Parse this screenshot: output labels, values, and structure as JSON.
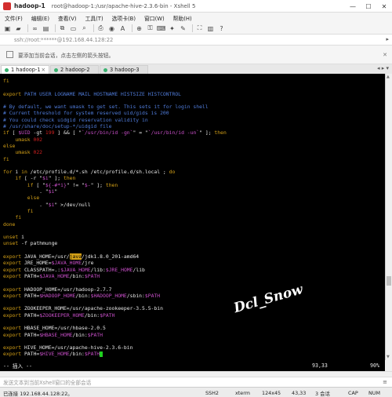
{
  "window": {
    "tab_title": "hadoop-1",
    "description": "root@hadoop-1:/usr/apache-hive-2.3.6-bin - Xshell 5",
    "minimize": "—",
    "maximize": "☐",
    "close": "✕"
  },
  "menu": [
    "文件(F)",
    "编辑(E)",
    "查看(V)",
    "工具(T)",
    "选项卡(B)",
    "窗口(W)",
    "帮助(H)"
  ],
  "address": {
    "value": "ssh://root:******@192.168.44.128:22"
  },
  "hint": {
    "text": "要添加当前会话，点击左侧的箭头按钮。"
  },
  "tabs": [
    {
      "label": "1 hadoop-1",
      "color": "#3cb371",
      "active": true
    },
    {
      "label": "2 hadoop-2",
      "color": "#3cb371",
      "active": false
    },
    {
      "label": "3 hadoop-3",
      "color": "#3cb371",
      "active": false
    }
  ],
  "terminal": {
    "lines": [
      [
        [
          "fi",
          "kw"
        ]
      ],
      [
        [
          "",
          ""
        ]
      ],
      [
        [
          "export",
          "kw"
        ],
        [
          " PATH USER LOGNAME MAIL HOSTNAME HISTSIZE HISTCONTROL",
          "cmt"
        ]
      ],
      [
        [
          "",
          ""
        ]
      ],
      [
        [
          "# By default, we want umask to get set. This sets it for login shell",
          "cmt"
        ]
      ],
      [
        [
          "# Current threshold for system reserved uid/gids is 200",
          "cmt"
        ]
      ],
      [
        [
          "# You could check uidgid reservation validity in",
          "cmt"
        ]
      ],
      [
        [
          "# /usr/share/doc/setup-*/uidgid file",
          "cmt"
        ]
      ],
      [
        [
          "if",
          "kw"
        ],
        [
          " [ ",
          "wht"
        ],
        [
          "$UID",
          "var"
        ],
        [
          " -gt ",
          "wht"
        ],
        [
          "199",
          "red"
        ],
        [
          " ] && [ \"",
          "wht"
        ],
        [
          "`/usr/bin/id -gn`",
          "str"
        ],
        [
          "\" = \"",
          "wht"
        ],
        [
          "`/usr/bin/id -un`",
          "str"
        ],
        [
          "\" ]; ",
          "wht"
        ],
        [
          "then",
          "kw"
        ]
      ],
      [
        [
          "    umask ",
          "kw"
        ],
        [
          "002",
          "red"
        ]
      ],
      [
        [
          "else",
          "kw"
        ]
      ],
      [
        [
          "    umask ",
          "kw"
        ],
        [
          "022",
          "red"
        ]
      ],
      [
        [
          "fi",
          "kw"
        ]
      ],
      [
        [
          "",
          ""
        ]
      ],
      [
        [
          "for",
          "kw"
        ],
        [
          " i ",
          "wht"
        ],
        [
          "in",
          "kw"
        ],
        [
          " /etc/profile.d/*.sh /etc/profile.d/sh.local ; ",
          "wht"
        ],
        [
          "do",
          "kw"
        ]
      ],
      [
        [
          "    if",
          "kw"
        ],
        [
          " [ -r \"",
          "wht"
        ],
        [
          "$i",
          "var"
        ],
        [
          "\" ]; ",
          "wht"
        ],
        [
          "then",
          "kw"
        ]
      ],
      [
        [
          "        if",
          "kw"
        ],
        [
          " [ \"",
          "wht"
        ],
        [
          "${-#*i}",
          "var"
        ],
        [
          "\" != \"",
          "wht"
        ],
        [
          "$-",
          "var"
        ],
        [
          "\" ]; ",
          "wht"
        ],
        [
          "then",
          "kw"
        ]
      ],
      [
        [
          "            . \"",
          "wht"
        ],
        [
          "$i",
          "var"
        ],
        [
          "\"",
          "wht"
        ]
      ],
      [
        [
          "        else",
          "kw"
        ]
      ],
      [
        [
          "            . \"",
          "wht"
        ],
        [
          "$i",
          "var"
        ],
        [
          "\" >/dev/null",
          "wht"
        ]
      ],
      [
        [
          "        fi",
          "kw"
        ]
      ],
      [
        [
          "    fi",
          "kw"
        ]
      ],
      [
        [
          "done",
          "kw"
        ]
      ],
      [
        [
          "",
          ""
        ]
      ],
      [
        [
          "unset",
          "kw"
        ],
        [
          " i",
          "wht"
        ]
      ],
      [
        [
          "unset",
          "kw"
        ],
        [
          " -f pathmunge",
          "wht"
        ]
      ],
      [
        [
          "",
          ""
        ]
      ],
      [
        [
          "export",
          "kw"
        ],
        [
          " JAVA_HOME=/usr/",
          "wht"
        ],
        [
          "java",
          "hl"
        ],
        [
          "/jdk1.8.0_201-amd64",
          "wht"
        ]
      ],
      [
        [
          "export",
          "kw"
        ],
        [
          " JRE_HOME=",
          "wht"
        ],
        [
          "$JAVA_HOME",
          "var"
        ],
        [
          "/jre",
          "wht"
        ]
      ],
      [
        [
          "export",
          "kw"
        ],
        [
          " CLASSPATH=.:",
          "wht"
        ],
        [
          "$JAVA_HOME",
          "var"
        ],
        [
          "/lib:",
          "wht"
        ],
        [
          "$JRE_HOME",
          "var"
        ],
        [
          "/lib",
          "wht"
        ]
      ],
      [
        [
          "export",
          "kw"
        ],
        [
          " PATH=",
          "wht"
        ],
        [
          "$JAVA_HOME",
          "var"
        ],
        [
          "/bin:",
          "wht"
        ],
        [
          "$PATH",
          "var"
        ]
      ],
      [
        [
          "",
          ""
        ]
      ],
      [
        [
          "export",
          "kw"
        ],
        [
          " HADOOP_HOME=/usr/hadoop-2.7.7",
          "wht"
        ]
      ],
      [
        [
          "export",
          "kw"
        ],
        [
          " PATH=",
          "wht"
        ],
        [
          "$HADOOP_HOME",
          "var"
        ],
        [
          "/bin:",
          "wht"
        ],
        [
          "$HADOOP_HOME",
          "var"
        ],
        [
          "/sbin:",
          "wht"
        ],
        [
          "$PATH",
          "var"
        ]
      ],
      [
        [
          "",
          ""
        ]
      ],
      [
        [
          "export",
          "kw"
        ],
        [
          " ZOOKEEPER_HOME=/usr/apache-zookeeper-3.5.5-bin",
          "wht"
        ]
      ],
      [
        [
          "export",
          "kw"
        ],
        [
          " PATH=",
          "wht"
        ],
        [
          "$ZOOKEEPER_HOME",
          "var"
        ],
        [
          "/bin:",
          "wht"
        ],
        [
          "$PATH",
          "var"
        ]
      ],
      [
        [
          "",
          ""
        ]
      ],
      [
        [
          "export",
          "kw"
        ],
        [
          " HBASE_HOME=/usr/hbase-2.0.5",
          "wht"
        ]
      ],
      [
        [
          "export",
          "kw"
        ],
        [
          " PATH=",
          "wht"
        ],
        [
          "$HBASE_HOME",
          "var"
        ],
        [
          "/bin:",
          "wht"
        ],
        [
          "$PATH",
          "var"
        ]
      ],
      [
        [
          "",
          ""
        ]
      ],
      [
        [
          "export",
          "kw"
        ],
        [
          " HIVE_HOME=/usr/apache-hive-2.3.6-bin",
          "wht"
        ]
      ],
      [
        [
          "export",
          "kw"
        ],
        [
          " PATH=",
          "wht"
        ],
        [
          "$HIVE_HOME",
          "var"
        ],
        [
          "/bin:",
          "wht"
        ],
        [
          "$PATH",
          "var"
        ],
        [
          "__CURSOR__",
          "cursor"
        ]
      ]
    ],
    "mode": "-- 插入 --",
    "position": "93,33",
    "percent": "90%",
    "watermark": "Dcl_Snow"
  },
  "input": {
    "placeholder": "发送文本到当前Xshell窗口的全部会话"
  },
  "status": {
    "connection": "已连接 192.168.44.128:22。",
    "protocol": "SSH2",
    "term": "xterm",
    "size": "124x45",
    "cursor": "43,33",
    "sessions": "3 会话",
    "caps": "CAP",
    "num": "NUM"
  }
}
